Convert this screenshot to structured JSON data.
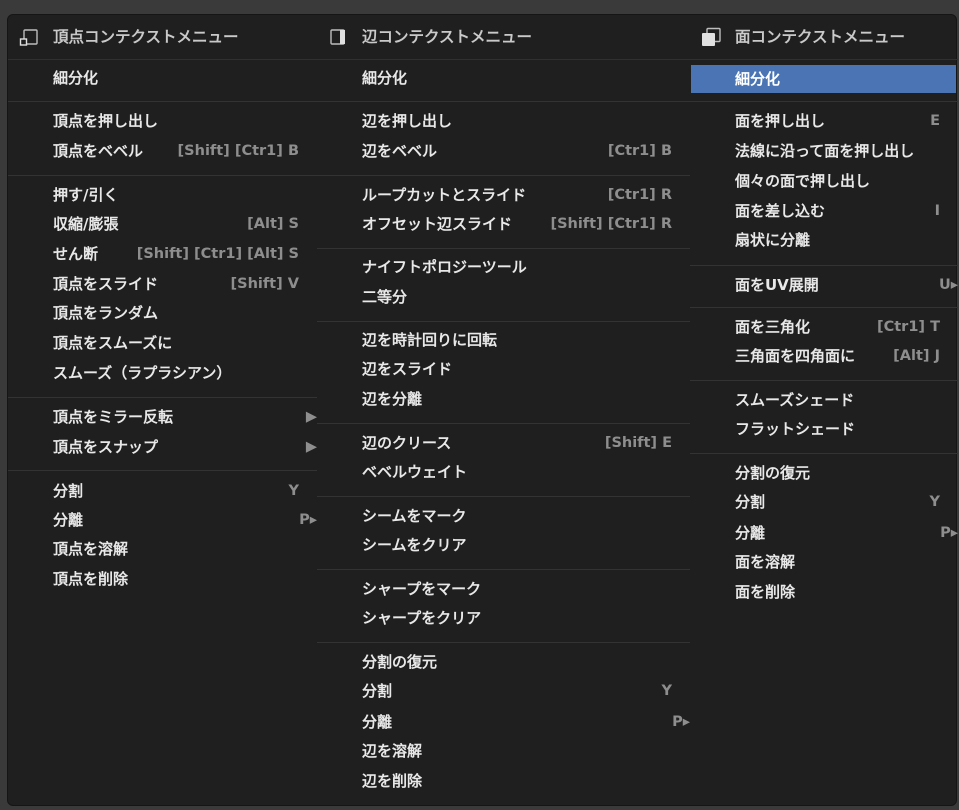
{
  "vertex": {
    "title": "頂点コンテクストメニュー",
    "header_icon": "vertex-icon",
    "items": [
      {
        "label": "細分化",
        "shortcut": ""
      },
      {
        "label": "頂点を押し出し",
        "shortcut": ""
      },
      {
        "label": "頂点をベベル",
        "shortcut": "[Shift] [Ctr1] B"
      },
      {
        "label": "押す/引く",
        "shortcut": ""
      },
      {
        "label": "収縮/膨張",
        "shortcut": "[Alt] S"
      },
      {
        "label": "せん断",
        "shortcut": "[Shift] [Ctr1] [Alt] S"
      },
      {
        "label": "頂点をスライド",
        "shortcut": "[Shift] V"
      },
      {
        "label": "頂点をランダム",
        "shortcut": ""
      },
      {
        "label": "頂点をスムーズに",
        "shortcut": ""
      },
      {
        "label": "スムーズ（ラプラシアン）",
        "shortcut": ""
      },
      {
        "label": "頂点をミラー反転",
        "shortcut": "▶"
      },
      {
        "label": "頂点をスナップ",
        "shortcut": "▶"
      },
      {
        "label": "分割",
        "shortcut": "Y"
      },
      {
        "label": "分離",
        "shortcut": "P▸"
      },
      {
        "label": "頂点を溶解",
        "shortcut": ""
      },
      {
        "label": "頂点を削除",
        "shortcut": ""
      }
    ]
  },
  "edge": {
    "title": "辺コンテクストメニュー",
    "header_icon": "edge-icon",
    "items": [
      {
        "label": "細分化",
        "shortcut": ""
      },
      {
        "label": "辺を押し出し",
        "shortcut": ""
      },
      {
        "label": "辺をベベル",
        "shortcut": "[Ctr1] B"
      },
      {
        "label": "ループカットとスライド",
        "shortcut": "[Ctr1] R"
      },
      {
        "label": "オフセット辺スライド",
        "shortcut": "[Shift] [Ctr1] R"
      },
      {
        "label": "ナイフトポロジーツール",
        "shortcut": ""
      },
      {
        "label": "二等分",
        "shortcut": ""
      },
      {
        "label": "辺を時計回りに回転",
        "shortcut": ""
      },
      {
        "label": "辺をスライド",
        "shortcut": ""
      },
      {
        "label": "辺を分離",
        "shortcut": ""
      },
      {
        "label": "辺のクリース",
        "shortcut": "[Shift] E"
      },
      {
        "label": "ベベルウェイト",
        "shortcut": ""
      },
      {
        "label": "シームをマーク",
        "shortcut": ""
      },
      {
        "label": "シームをクリア",
        "shortcut": ""
      },
      {
        "label": "シャープをマーク",
        "shortcut": ""
      },
      {
        "label": "シャープをクリア",
        "shortcut": ""
      },
      {
        "label": "分割の復元",
        "shortcut": ""
      },
      {
        "label": "分割",
        "shortcut": "Y"
      },
      {
        "label": "分離",
        "shortcut": "P▸"
      },
      {
        "label": "辺を溶解",
        "shortcut": ""
      },
      {
        "label": "辺を削除",
        "shortcut": ""
      }
    ]
  },
  "face": {
    "title": "面コンテクストメニュー",
    "header_icon": "face-icon",
    "items": [
      {
        "label": "細分化",
        "shortcut": ""
      },
      {
        "label": "面を押し出し",
        "shortcut": "E"
      },
      {
        "label": "法線に沿って面を押し出し",
        "shortcut": ""
      },
      {
        "label": "個々の面で押し出し",
        "shortcut": ""
      },
      {
        "label": "面を差し込む",
        "shortcut": "I"
      },
      {
        "label": "扇状に分離",
        "shortcut": ""
      },
      {
        "label": "面をUV展開",
        "shortcut": "U▸"
      },
      {
        "label": "面を三角化",
        "shortcut": "[Ctr1] T"
      },
      {
        "label": "三角面を四角面に",
        "shortcut": "[Alt] J"
      },
      {
        "label": "スムーズシェード",
        "shortcut": ""
      },
      {
        "label": "フラットシェード",
        "shortcut": ""
      },
      {
        "label": "分割の復元",
        "shortcut": ""
      },
      {
        "label": "分割",
        "shortcut": "Y"
      },
      {
        "label": "分離",
        "shortcut": "P▸"
      },
      {
        "label": "面を溶解",
        "shortcut": ""
      },
      {
        "label": "面を削除",
        "shortcut": ""
      }
    ]
  },
  "colors": {
    "highlight": "#4a74b4",
    "panel": "#1f1f1f",
    "shortcut_text": "#8e8e8e"
  }
}
